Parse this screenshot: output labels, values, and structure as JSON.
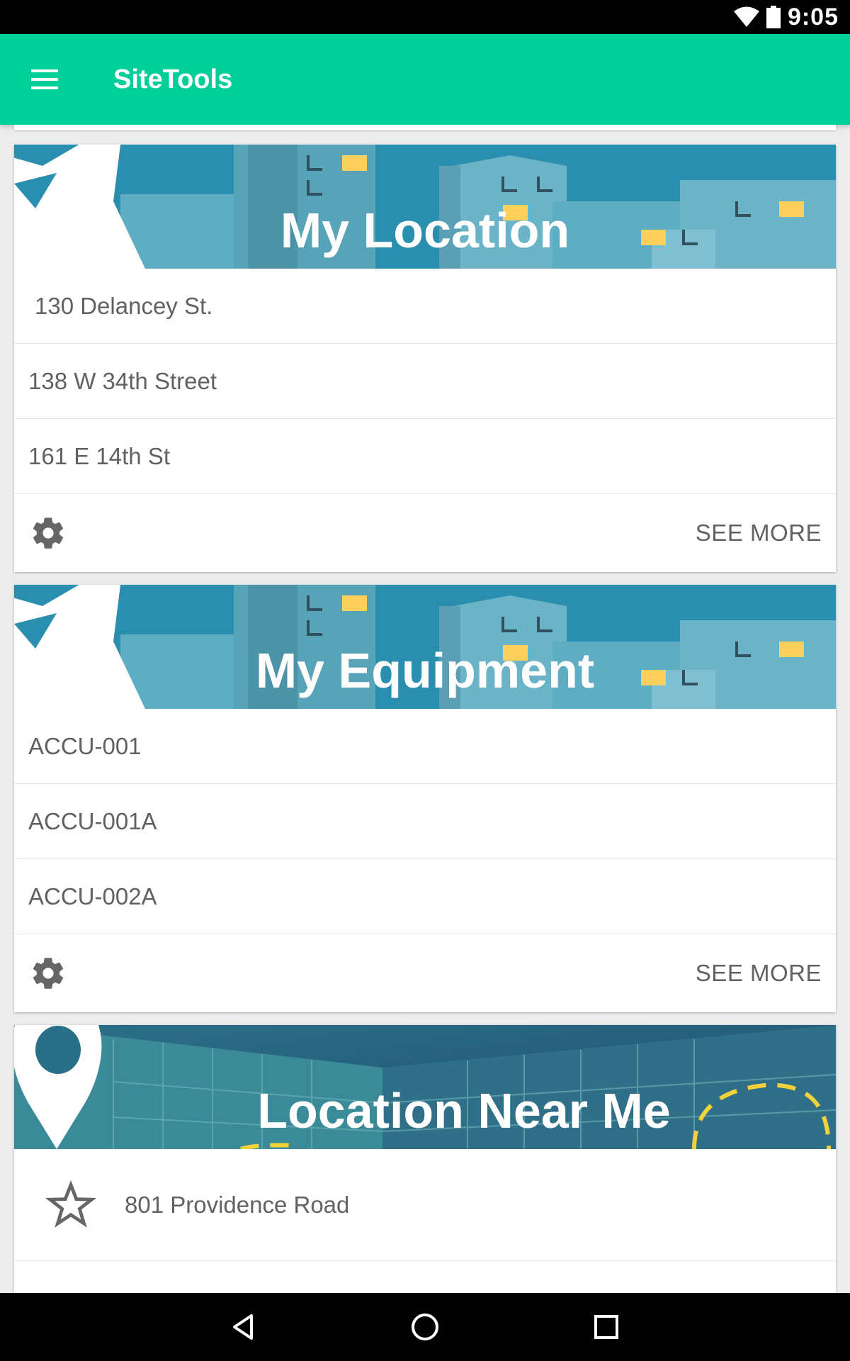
{
  "status_bar": {
    "time": "9:05"
  },
  "app_bar": {
    "title": "SiteTools"
  },
  "cards": {
    "my_location": {
      "title": "My Location",
      "items": [
        "130 Delancey St.",
        "138 W 34th Street",
        "161 E 14th St"
      ],
      "see_more": "SEE MORE"
    },
    "my_equipment": {
      "title": "My Equipment",
      "items": [
        "ACCU-001",
        "ACCU-001A",
        "ACCU-002A"
      ],
      "see_more": "SEE MORE"
    },
    "location_near_me": {
      "title": "Location Near Me",
      "items": [
        "801 Providence Road"
      ]
    }
  },
  "colors": {
    "accent": "#00cf99",
    "header_bg": "#2a8fae",
    "window_light": "#ffd15c"
  },
  "icons": [
    "wifi-icon",
    "battery-icon",
    "menu-icon",
    "settings-gear-icon",
    "star-outline-icon",
    "nav-back-icon",
    "nav-home-icon",
    "nav-recents-icon"
  ]
}
